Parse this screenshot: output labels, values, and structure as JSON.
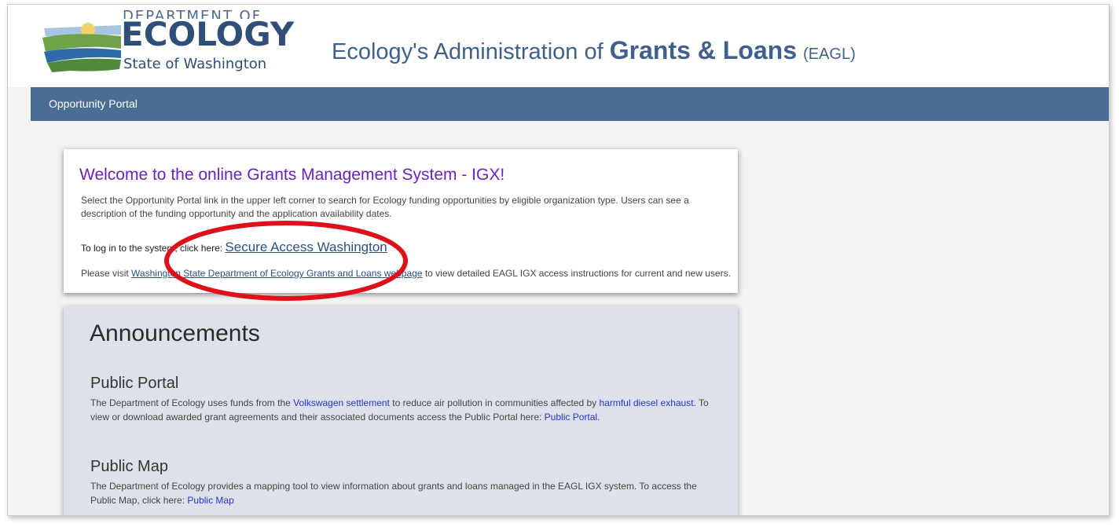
{
  "header": {
    "logo_line1": "DEPARTMENT OF",
    "logo_line2": "ECOLOGY",
    "logo_line3": "State of Washington",
    "title_prefix": "Ecology's Administration of",
    "title_bold": "Grants & Loans",
    "title_suffix": "(EAGL)"
  },
  "nav": {
    "opportunity_portal": "Opportunity Portal"
  },
  "welcome": {
    "title": "Welcome to the online Grants Management System - IGX!",
    "description": "Select the Opportunity Portal link in the upper left corner to search for Ecology funding opportunities by eligible organization type. Users can see a description of the funding opportunity and the application availability dates.",
    "login_prefix": "To log in to the system, click here:",
    "login_link": "Secure Access Washington",
    "visit_prefix": "Please visit",
    "visit_link": "Washington State Department of Ecology Grants and Loans webpage",
    "visit_suffix": "to view detailed EAGL IGX access instructions for current and new users."
  },
  "announcements": {
    "title": "Announcements",
    "public_portal": {
      "heading": "Public Portal",
      "text1": "The Department of Ecology uses funds from the",
      "link1": "Volkswagen settlement",
      "text2": "to reduce air pollution in communities affected by",
      "link2": "harmful diesel exhaust",
      "text3": ". To view or download awarded grant agreements and their associated documents access the Public Portal here:",
      "link3": "Public Portal",
      "text4": "."
    },
    "public_map": {
      "heading": "Public Map",
      "text1": "The Department of Ecology provides a mapping tool to view information about grants and loans managed in the EAGL IGX system. To access the Public Map, click here:",
      "link1": "Public Map"
    }
  },
  "colors": {
    "navbar": "#4a6d93",
    "welcome_title": "#6c1fc8",
    "announcement_bg": "#dde2ea",
    "highlight_ellipse": "#e0101a"
  }
}
